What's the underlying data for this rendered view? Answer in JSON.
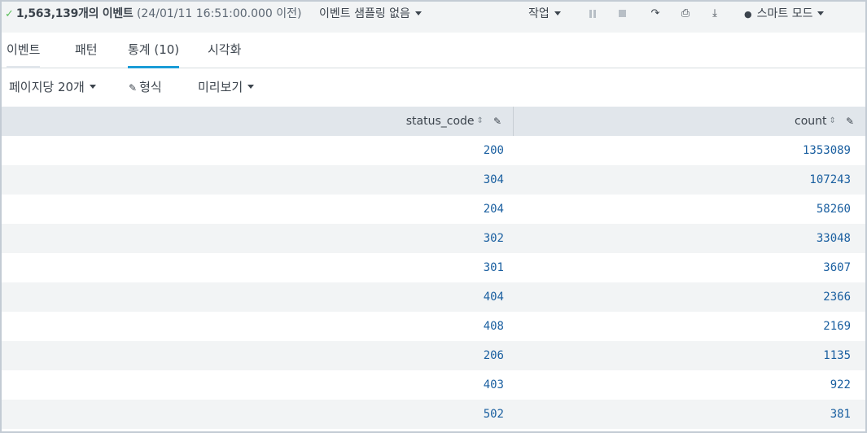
{
  "status_bar": {
    "check_icon": "check-icon",
    "event_count": "1,563,139개의 이벤트",
    "time_range": "(24/01/11 16:51:00.000 이전)",
    "sampling_label": "이벤트 샘플링 없음",
    "job_label": "작업",
    "mode_label": "스마트 모드"
  },
  "tabs": [
    {
      "label": "이벤트"
    },
    {
      "label": "패턴"
    },
    {
      "label": "통계 (10)"
    },
    {
      "label": "시각화"
    }
  ],
  "toolbar": {
    "per_page_label": "페이지당 20개",
    "format_label": "형식",
    "preview_label": "미리보기"
  },
  "table": {
    "columns": [
      "status_code",
      "count"
    ],
    "rows": [
      [
        "200",
        "1353089"
      ],
      [
        "304",
        "107243"
      ],
      [
        "204",
        "58260"
      ],
      [
        "302",
        "33048"
      ],
      [
        "301",
        "3607"
      ],
      [
        "404",
        "2366"
      ],
      [
        "408",
        "2169"
      ],
      [
        "206",
        "1135"
      ],
      [
        "403",
        "922"
      ],
      [
        "502",
        "381"
      ]
    ]
  },
  "colors": {
    "accent": "#1a9cd7",
    "value_text": "#1a5fa0",
    "header_bg": "#e1e6eb",
    "stripe_bg": "#f2f4f5"
  }
}
